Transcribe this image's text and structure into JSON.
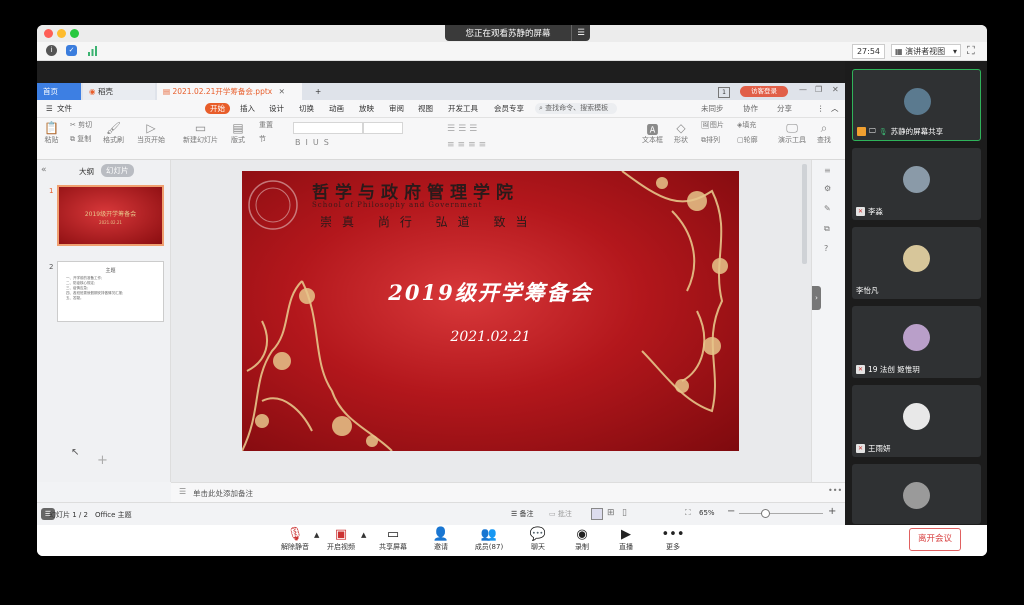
{
  "meeting": {
    "banner_text": "您正在观看苏静的屏幕",
    "timer": "27:54",
    "view_mode": "演讲者视图"
  },
  "wps": {
    "tabs": [
      {
        "label": "首页"
      },
      {
        "label": "稻壳"
      },
      {
        "label": "2021.02.21开学筹备会.pptx"
      }
    ],
    "page_badge": "1",
    "login_button": "访客登录",
    "menu": {
      "file": "文件",
      "start": "开始",
      "items": [
        "插入",
        "设计",
        "切换",
        "动画",
        "放映",
        "审阅",
        "视图",
        "开发工具",
        "会员专享"
      ],
      "search": "查找命令、搜索模板",
      "sync": "未同步",
      "collab": "协作",
      "share": "分享"
    },
    "tools": {
      "paste": "粘贴",
      "cut": "剪切",
      "copy": "复制",
      "format_painter": "格式刷",
      "from_current": "当页开始",
      "new_slide": "新建幻灯片",
      "layout": "版式",
      "section": "节",
      "reset": "重置",
      "textbox": "文本框",
      "shape": "形状",
      "picture": "图片",
      "fill": "填充",
      "arrange": "排列",
      "outline": "轮廓",
      "present_tools": "演示工具",
      "find": "查找"
    },
    "panel_tabs": {
      "outline": "大纲",
      "slides": "幻灯片"
    },
    "thumb1": {
      "number": "1",
      "title": "2019级开学筹备会",
      "date": "2021.02.21"
    },
    "thumb2": {
      "number": "2",
      "heading": "主题",
      "lines": [
        "一、开学前的准备工作;",
        "二、防疫核心规定;",
        "三、疫情应急;",
        "四、各班班委就假期安排做情况汇报;",
        "五、答疑。"
      ]
    },
    "slide": {
      "school_name": "哲学与政府管理学院",
      "school_name_en": "School of Philosophy and Government",
      "motto": "崇真 尚行 弘道 致当",
      "title": "2019级开学筹备会",
      "date": "2021.02.21"
    },
    "notes_placeholder": "单击此处添加备注",
    "status": {
      "slide_count": "幻灯片 1 / 2",
      "theme": "Office 主题",
      "notes": "备注",
      "comments": "批注",
      "zoom": "65%"
    }
  },
  "participants": [
    {
      "name": "苏静的屏幕共享",
      "color": "#5b7a8f"
    },
    {
      "name": "李淼",
      "color": "#8a9aa8"
    },
    {
      "name": "李怡凡",
      "color": "#d7c69a"
    },
    {
      "name": "19 法创 姬惟玥",
      "color": "#b99fc9"
    },
    {
      "name": "王雨妍",
      "color": "#e8e8e8"
    },
    {
      "name": "",
      "color": "#9a9a9a"
    }
  ],
  "controls": [
    {
      "label": "解除静音",
      "icon": "mic-muted-icon",
      "glyph": "🎙"
    },
    {
      "label": "开启视频",
      "icon": "camera-off-icon",
      "glyph": "▣"
    },
    {
      "label": "共享屏幕",
      "icon": "share-screen-icon",
      "glyph": "▭"
    },
    {
      "label": "邀请",
      "icon": "invite-icon",
      "glyph": "👤"
    },
    {
      "label": "成员(87)",
      "icon": "members-icon",
      "glyph": "👥"
    },
    {
      "label": "聊天",
      "icon": "chat-icon",
      "glyph": "💬"
    },
    {
      "label": "录制",
      "icon": "record-icon",
      "glyph": "◉"
    },
    {
      "label": "直播",
      "icon": "live-icon",
      "glyph": "▶"
    },
    {
      "label": "更多",
      "icon": "more-icon",
      "glyph": "•••"
    }
  ],
  "leave_button": "离开会议",
  "colors": {
    "wps_accent": "#e85d2a",
    "slide_red": "#b3171c",
    "gold": "#e7c58a",
    "speaker_border": "#2fb35a",
    "leave_red": "#d84040"
  }
}
